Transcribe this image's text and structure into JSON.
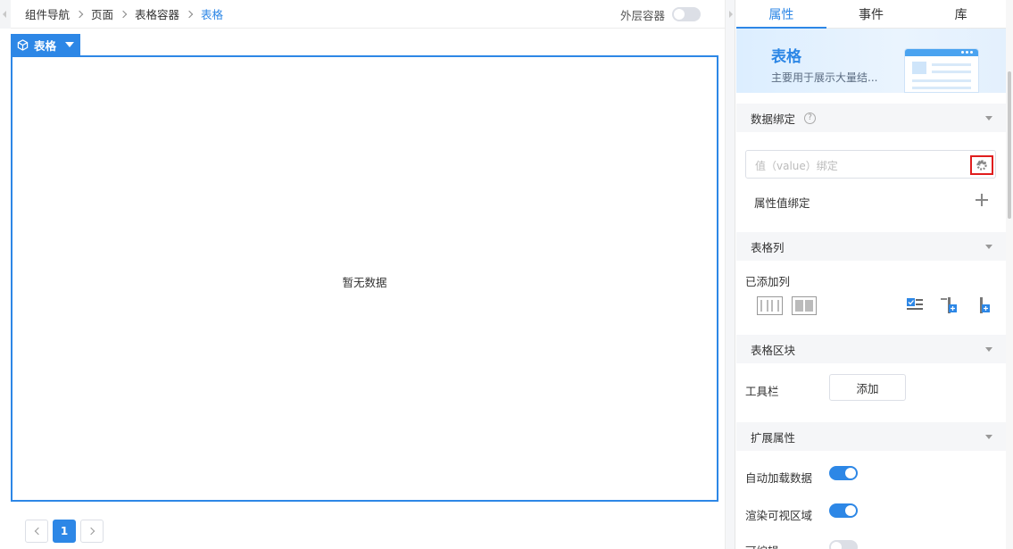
{
  "breadcrumb": {
    "items": [
      "组件导航",
      "页面",
      "表格容器",
      "表格"
    ]
  },
  "canvas": {
    "outer_container_label": "外层容器",
    "outer_container_on": false,
    "component_tag": "表格",
    "empty_text": "暂无数据"
  },
  "pagination": {
    "current_page": "1"
  },
  "panel": {
    "tabs": [
      "属性",
      "事件",
      "库"
    ],
    "active_tab": "属性",
    "hero": {
      "title": "表格",
      "description": "主要用于展示大量结..."
    },
    "data_binding": {
      "title": "数据绑定",
      "help": "?",
      "value_placeholder": "值（value）绑定",
      "attr_binding_label": "属性值绑定"
    },
    "table_columns": {
      "title": "表格列",
      "added_label": "已添加列"
    },
    "table_blocks": {
      "title": "表格区块",
      "toolbar_label": "工具栏",
      "add_button": "添加"
    },
    "extended": {
      "title": "扩展属性",
      "toggles": [
        {
          "label": "自动加载数据",
          "on": true
        },
        {
          "label": "渲染可视区域",
          "on": true
        },
        {
          "label": "可编辑",
          "on": false
        }
      ]
    }
  },
  "colors": {
    "accent": "#2d87e6",
    "highlight_border": "#e01e1e",
    "section_bg": "#f5f6f8"
  }
}
